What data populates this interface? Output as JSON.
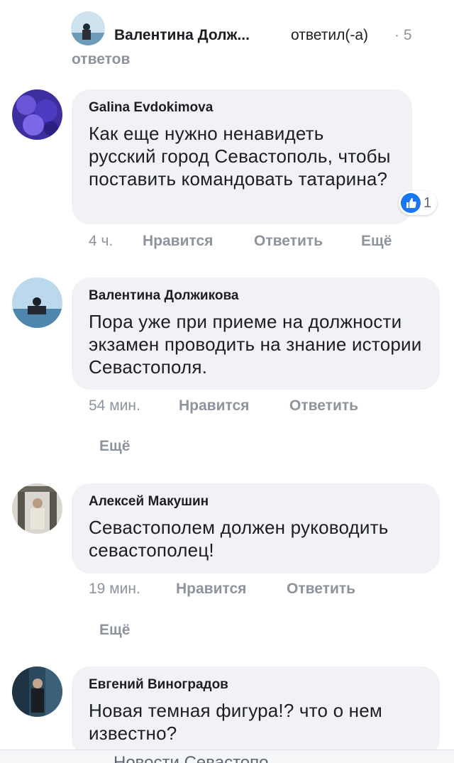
{
  "reply_summary": {
    "name": "Валентина Долж...",
    "action": "ответил(-а)",
    "count": "· 5",
    "answers": "ответов"
  },
  "comments": [
    {
      "author": "Galina Evdokimova",
      "text": "Как еще нужно ненавидеть русский город Севастополь, чтобы поставить командовать татарина?",
      "time": "4 ч.",
      "like_label": "Нравится",
      "reply_label": "Ответить",
      "more_label": "Ещё",
      "reaction_count": "1",
      "reaction_icon": "like-icon"
    },
    {
      "author": "Валентина Должикова",
      "text": "Пора уже при приеме на должности экзамен проводить на знание истории Севастополя.",
      "time": "54 мин.",
      "like_label": "Нравится",
      "reply_label": "Ответить",
      "more_label": "Ещё"
    },
    {
      "author": "Алексей Макушин",
      "text": "Севастополем должен руководить севастополец!",
      "time": "19 мин.",
      "like_label": "Нравится",
      "reply_label": "Ответить",
      "more_label": "Ещё"
    },
    {
      "author": "Евгений Виноградов",
      "text": "Новая темная фигура!? что о нем известно?"
    }
  ],
  "bottom_bar": {
    "label": "Новости Севастопо..."
  },
  "colors": {
    "bubble": "#f0f2f5",
    "meta": "#8d949e",
    "like_blue": "#1877f2"
  }
}
